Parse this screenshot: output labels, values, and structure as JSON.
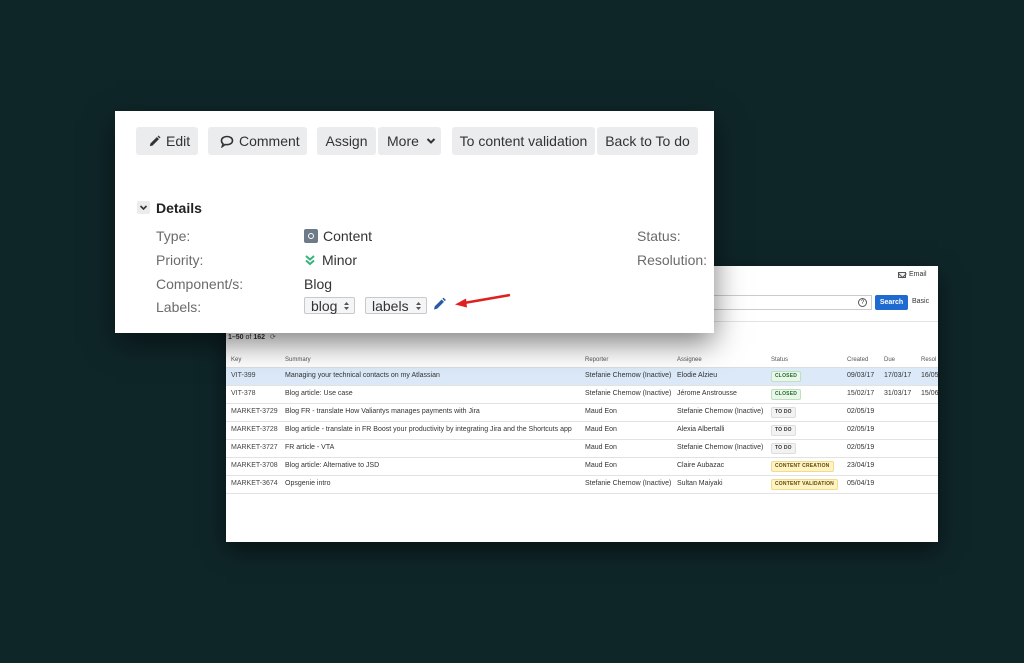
{
  "list_panel": {
    "email_label": "Email",
    "help_glyph": "?",
    "search_button": "Search",
    "basic_link": "Basic",
    "count_range": "1–50",
    "count_of": "of",
    "count_total": "162",
    "refresh_glyph": "⟳",
    "columns": [
      "Key",
      "Summary",
      "Reporter",
      "Assignee",
      "Status",
      "Created",
      "Due",
      "Resol"
    ],
    "rows": [
      {
        "key": "VIT-399",
        "summary": "Managing your technical contacts on my Atlassian",
        "reporter": "Stefanie Chernow (Inactive)",
        "assignee": "Elodie Alzieu",
        "status": "CLOSED",
        "created": "09/03/17",
        "due": "17/03/17",
        "resolved": "16/05"
      },
      {
        "key": "VIT-378",
        "summary": "Blog article: Use case",
        "reporter": "Stefanie Chernow (Inactive)",
        "assignee": "Jérome Anstrousse",
        "status": "CLOSED",
        "created": "15/02/17",
        "due": "31/03/17",
        "resolved": "15/06"
      },
      {
        "key": "MARKET-3729",
        "summary": "Blog FR - translate How Valiantys manages payments with Jira",
        "reporter": "Maud Eon",
        "assignee": "Stefanie Chernow (Inactive)",
        "status": "TO DO",
        "created": "02/05/19",
        "due": "",
        "resolved": ""
      },
      {
        "key": "MARKET-3728",
        "summary": "Blog article - translate in FR Boost your productivity by integrating Jira and the Shortcuts app",
        "reporter": "Maud Eon",
        "assignee": "Alexia Albertalli",
        "status": "TO DO",
        "created": "02/05/19",
        "due": "",
        "resolved": ""
      },
      {
        "key": "MARKET-3727",
        "summary": "FR article - VTA",
        "reporter": "Maud Eon",
        "assignee": "Stefanie Chernow (Inactive)",
        "status": "TO DO",
        "created": "02/05/19",
        "due": "",
        "resolved": ""
      },
      {
        "key": "MARKET-3708",
        "summary": "Blog article: Alternative to JSD",
        "reporter": "Maud Eon",
        "assignee": "Claire Aubazac",
        "status": "CONTENT CREATION",
        "created": "23/04/19",
        "due": "",
        "resolved": ""
      },
      {
        "key": "MARKET-3674",
        "summary": "Opsgenie intro",
        "reporter": "Stefanie Chernow (Inactive)",
        "assignee": "Sultan Maiyaki",
        "status": "CONTENT VALIDATION",
        "created": "05/04/19",
        "due": "",
        "resolved": ""
      }
    ]
  },
  "toolbar": {
    "edit": "Edit",
    "comment": "Comment",
    "assign": "Assign",
    "more": "More",
    "to_content_validation": "To content validation",
    "back_to_todo": "Back to To do"
  },
  "details": {
    "title": "Details",
    "type_label": "Type:",
    "type_value": "Content",
    "priority_label": "Priority:",
    "priority_value": "Minor",
    "component_label": "Component/s:",
    "component_value": "Blog",
    "labels_label": "Labels:",
    "labels": [
      "blog",
      "labels"
    ],
    "status_label": "Status:",
    "resolution_label": "Resolution:"
  },
  "colors": {
    "page_background": "#0f2629",
    "button_bg": "#eaeced",
    "selected_row": "#dbe9f8",
    "search_button": "#1f6ad1",
    "arrow": "#e02020",
    "priority_minor": "#36b37e"
  }
}
